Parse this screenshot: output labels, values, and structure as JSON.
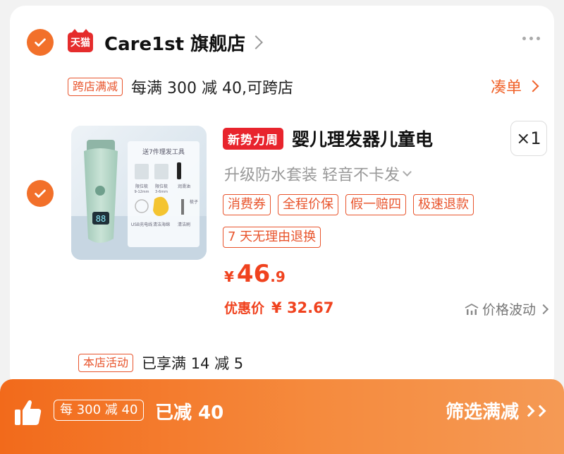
{
  "shop": {
    "badge": "天猫",
    "name": "Care1st 旗舰店",
    "cross_store_tag": "跨店满减",
    "cross_store_text": "每满 300 减 40,可跨店",
    "coudan_label": "凑单"
  },
  "product": {
    "badge": "新势力周",
    "title": "婴儿理发器儿童电",
    "quantity": "×1",
    "spec": "升级防水套装  轻音不卡发",
    "service_tags": [
      "消费券",
      "全程价保",
      "假一赔四",
      "极速退款"
    ],
    "return_tag": "7 天无理由退换",
    "price_currency": "¥",
    "price_int": "46",
    "price_dec": ".9",
    "discount_label": "优惠价",
    "discount_value": "¥ 32.67",
    "price_volatility": "价格波动",
    "image_text": {
      "header": "送7件理发工具",
      "guard1": "限位梳",
      "guard1_size": "9-12mm",
      "guard2": "限位梳",
      "guard2_size": "3-6mm",
      "item3": "润滑油",
      "item4": "USB充电线",
      "item5": "清洁海绵",
      "item6": "清洁刷",
      "comb": "梳子",
      "display": "88"
    }
  },
  "store_activity": {
    "tag": "本店活动",
    "text": "已享满 14 减 5"
  },
  "bottom_bar": {
    "tag": "每 300 减 40",
    "reduced": "已减 40",
    "filter_label": "筛选满减"
  },
  "colors": {
    "accent": "#f2702a",
    "price": "#f0421e",
    "badge_red": "#e8242d"
  }
}
